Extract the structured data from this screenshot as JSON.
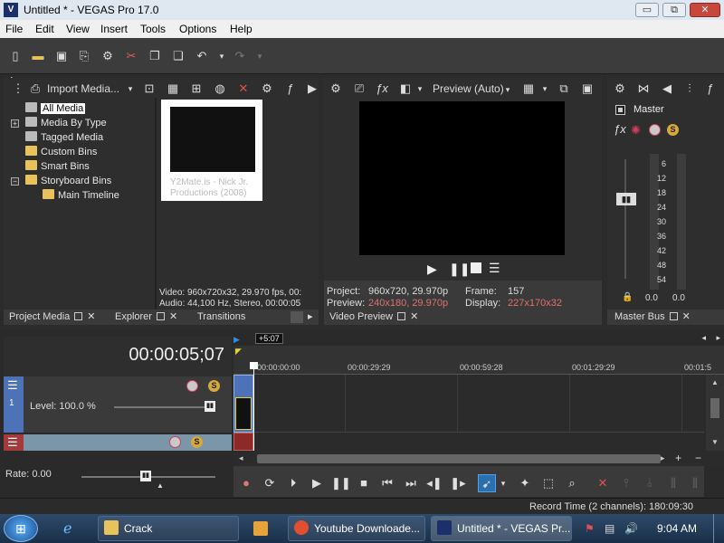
{
  "window": {
    "title": "Untitled * - VEGAS Pro 17.0",
    "app_icon": "V",
    "minimize": "▭",
    "maximize": "⧉",
    "close": "✕"
  },
  "menu": [
    "File",
    "Edit",
    "View",
    "Insert",
    "Tools",
    "Options",
    "Help"
  ],
  "project_media": {
    "import_label": "Import Media...",
    "tree": [
      "All Media",
      "Media By Type",
      "Tagged Media",
      "Custom Bins",
      "Smart Bins",
      "Storyboard Bins",
      "Main Timeline"
    ],
    "expanders": [
      "+",
      "−"
    ],
    "thumbnail_caption": "Y2Mate.is - Nick Jr. Productions (2008)",
    "info_video": "Video: 960x720x32, 29.970 fps, 00:",
    "info_audio": "Audio: 44,100 Hz, Stereo, 00:00:05"
  },
  "preview": {
    "mode": "Preview (Auto)",
    "project_label": "Project:",
    "project_value": "960x720, 29.970p",
    "preview_label": "Preview:",
    "preview_value": "240x180, 29.970p",
    "frame_label": "Frame:",
    "frame_value": "157",
    "display_label": "Display:",
    "display_value": "227x170x32"
  },
  "master": {
    "label": "Master",
    "scale": [
      "6",
      "12",
      "18",
      "24",
      "30",
      "36",
      "42",
      "48",
      "54"
    ],
    "dash": "-",
    "bottom_left": "0.0",
    "bottom_right": "0.0"
  },
  "tabs": {
    "project_media": "Project Media",
    "explorer": "Explorer",
    "transitions": "Transitions",
    "video_preview": "Video Preview",
    "master_bus": "Master Bus"
  },
  "timeline": {
    "timecode": "00:00:05;07",
    "marker": "+5:07",
    "ruler": [
      "00:00:00:00",
      "00:00:29:29",
      "00:00:59:28",
      "00:01:29:29",
      "00:01:5"
    ],
    "video_level": "Level: 100.0 %",
    "rate": "Rate: 0.00",
    "track_num": "1",
    "zoom_in": "+",
    "zoom_out": "−"
  },
  "status": {
    "record_time": "Record Time (2 channels): 180:09:30"
  },
  "taskbar": {
    "tasks": [
      "Crack",
      "Youtube Downloade...",
      "Untitled * - VEGAS Pr..."
    ],
    "clock": "9:04 AM"
  },
  "colors": {
    "accent": "#2a6fb0",
    "preview_red": "#e07070",
    "master_fx": "#d23c5a",
    "solo": "#d7a83a"
  }
}
